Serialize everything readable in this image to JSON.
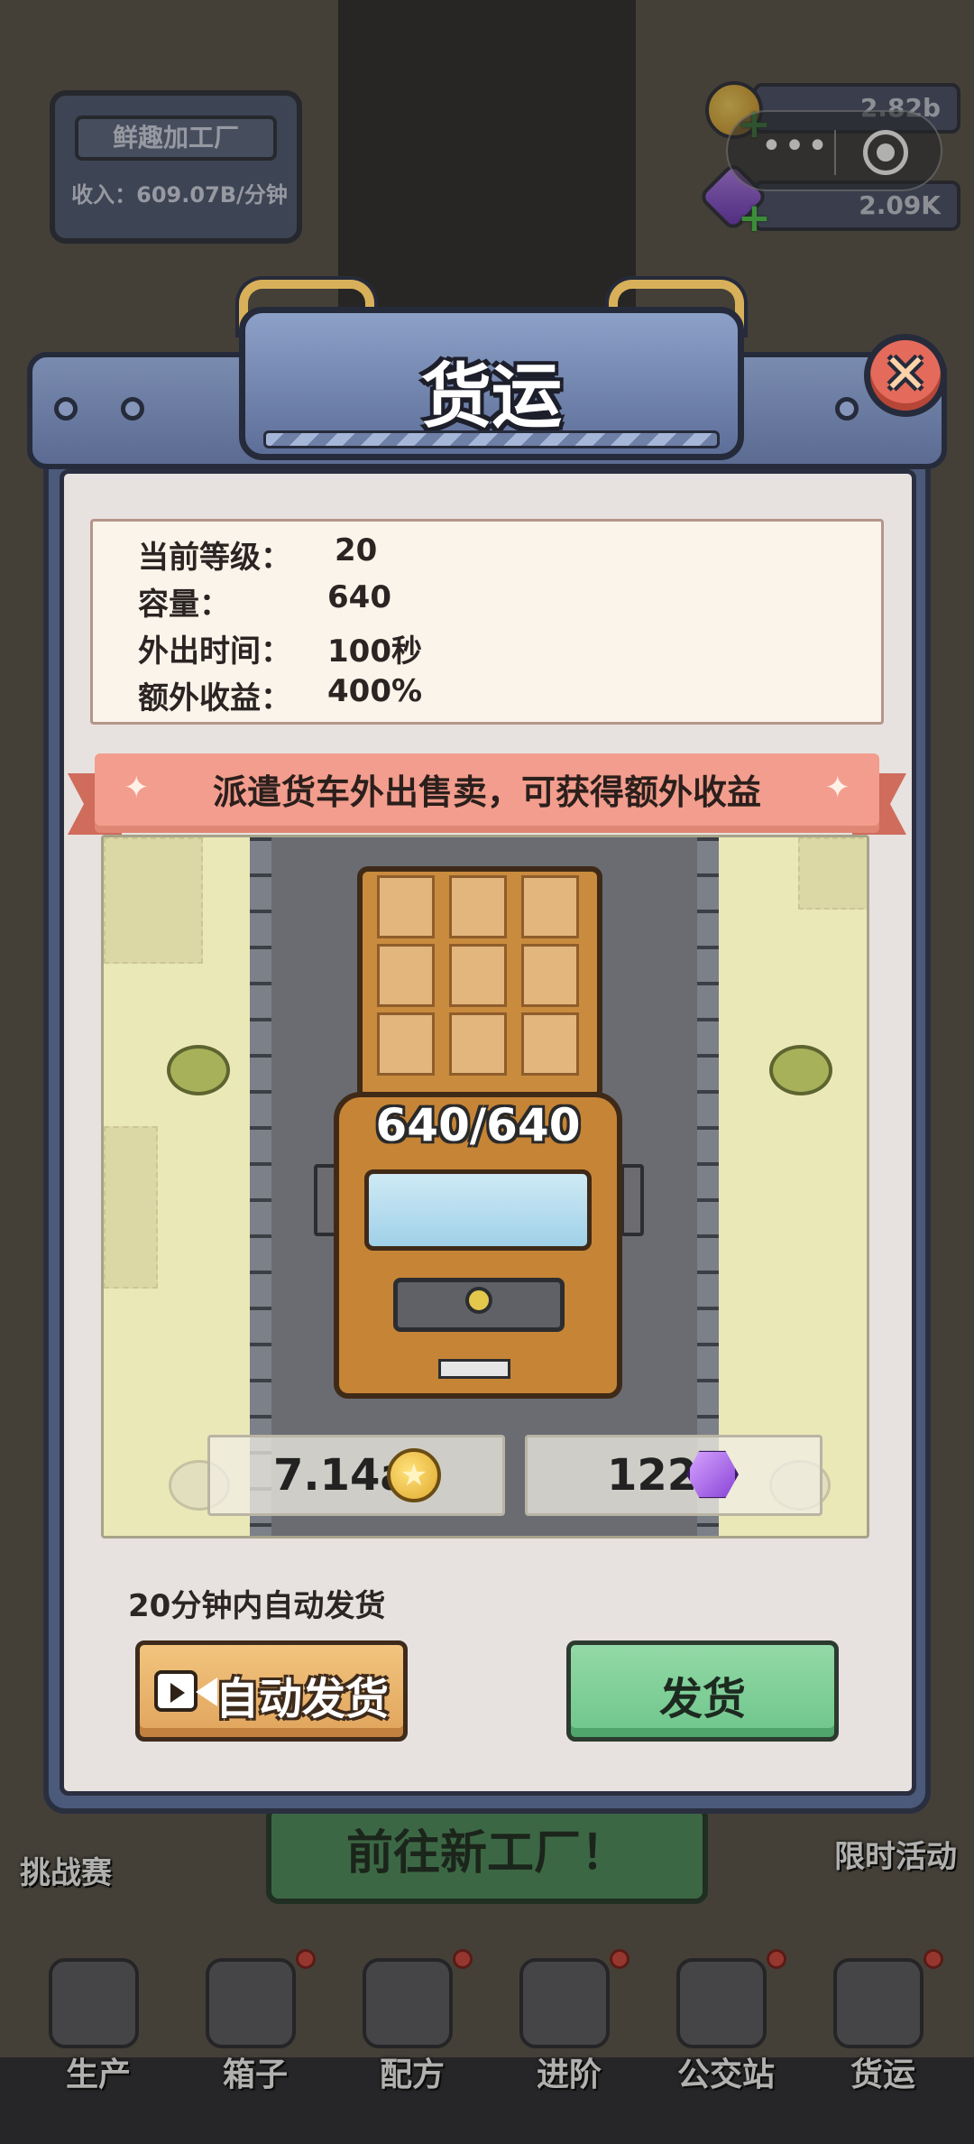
{
  "screen": {
    "factory": {
      "name": "鲜趣加工厂",
      "income": "收入：609.07B/分钟"
    },
    "resources": {
      "coins": "2.82b",
      "gems": "2.09K"
    },
    "side": {
      "challenge": "挑战赛",
      "limited_event": "限时活动"
    },
    "goto_new_factory": "前往新工厂！",
    "nav": [
      {
        "label": "生产",
        "icon": "robot-arm-icon"
      },
      {
        "label": "箱子",
        "icon": "crate-icon"
      },
      {
        "label": "配方",
        "icon": "book-icon"
      },
      {
        "label": "进阶",
        "icon": "upgrade-icon"
      },
      {
        "label": "公交站",
        "icon": "bus-stop-icon"
      },
      {
        "label": "货运",
        "icon": "cargo-icon"
      }
    ]
  },
  "modal": {
    "title": "货运",
    "info": [
      {
        "label": "当前等级：",
        "value": "20"
      },
      {
        "label": "容量：",
        "value": "640"
      },
      {
        "label": "外出时间：",
        "value": "100秒"
      },
      {
        "label": "额外收益：",
        "value": "400%"
      }
    ],
    "banner": "派遣货车外出售卖，可获得额外收益",
    "truck_load": "640/640",
    "rewards": {
      "coins": "7.14a",
      "gems": "122"
    },
    "auto_note": "20分钟内自动发货",
    "auto_button": "自动发货",
    "ship_button": "发货"
  },
  "colors": {
    "ribbon": "#f29d8d",
    "auto_button": "#e8ae64",
    "ship_button": "#7fce97",
    "close_button": "#e46b5b"
  }
}
